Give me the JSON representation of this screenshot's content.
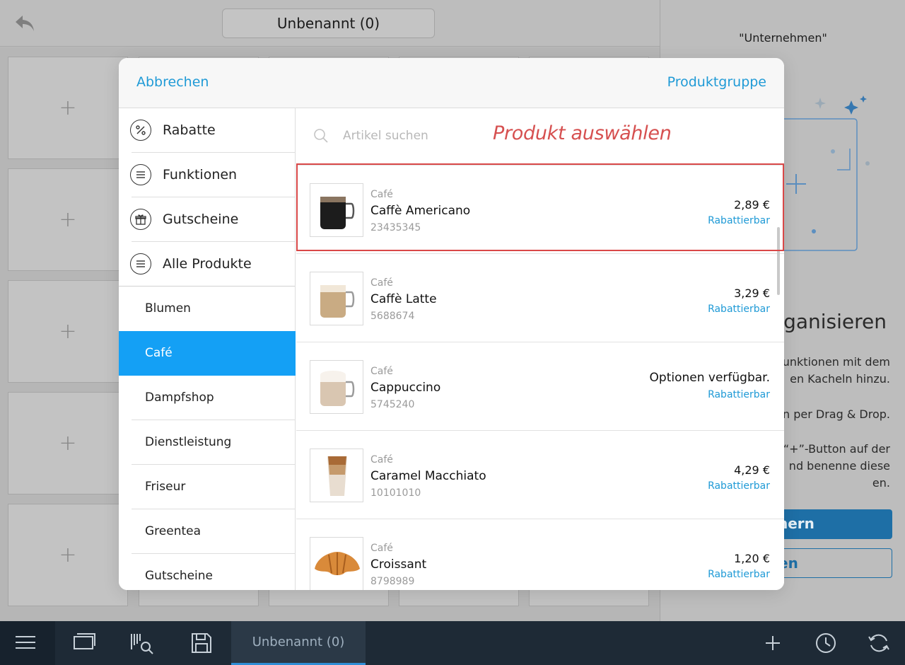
{
  "app": {
    "document_title": "Unbenannt (0)",
    "right_panel": {
      "quote": "\"Unternehmen\"",
      "heading": "ganisieren",
      "text_lines": [
        "unktionen mit dem",
        "en Kacheln hinzu.",
        "n per Drag & Drop.",
        "“+”-Button auf der",
        "nd benenne diese",
        "en."
      ],
      "button_primary": "nern",
      "button_secondary": "en"
    }
  },
  "bottom_bar": {
    "active_tab_label": "Unbenannt (0)"
  },
  "modal": {
    "cancel_label": "Abbrechen",
    "group_label": "Produktgruppe",
    "search_placeholder": "Artikel suchen",
    "annotation": "Produkt auswählen",
    "main_categories": [
      {
        "label": "Rabatte",
        "icon": "percent-icon"
      },
      {
        "label": "Funktionen",
        "icon": "list-icon"
      },
      {
        "label": "Gutscheine",
        "icon": "gift-icon"
      },
      {
        "label": "Alle Produkte",
        "icon": "list-icon"
      }
    ],
    "sub_categories": [
      "Blumen",
      "Café",
      "Dampfshop",
      "Dienstleistung",
      "Friseur",
      "Greentea",
      "Gutscheine"
    ],
    "active_sub_category": "Café",
    "products": [
      {
        "category": "Café",
        "name": "Caffè Americano",
        "code": "23435345",
        "price": "2,89 €",
        "discount": "Rabattierbar"
      },
      {
        "category": "Café",
        "name": "Caffè Latte",
        "code": "5688674",
        "price": "3,29 €",
        "discount": "Rabattierbar"
      },
      {
        "category": "Café",
        "name": "Cappuccino",
        "code": "5745240",
        "price": "Optionen verfügbar.",
        "discount": "Rabattierbar"
      },
      {
        "category": "Café",
        "name": "Caramel Macchiato",
        "code": "10101010",
        "price": "4,29 €",
        "discount": "Rabattierbar"
      },
      {
        "category": "Café",
        "name": "Croissant",
        "code": "8798989",
        "price": "1,20 €",
        "discount": "Rabattierbar"
      }
    ]
  },
  "colors": {
    "accent": "#1f9ad6",
    "active_category": "#14a0f5",
    "annotation": "#d94848",
    "toolbar": "#1e2a36"
  }
}
